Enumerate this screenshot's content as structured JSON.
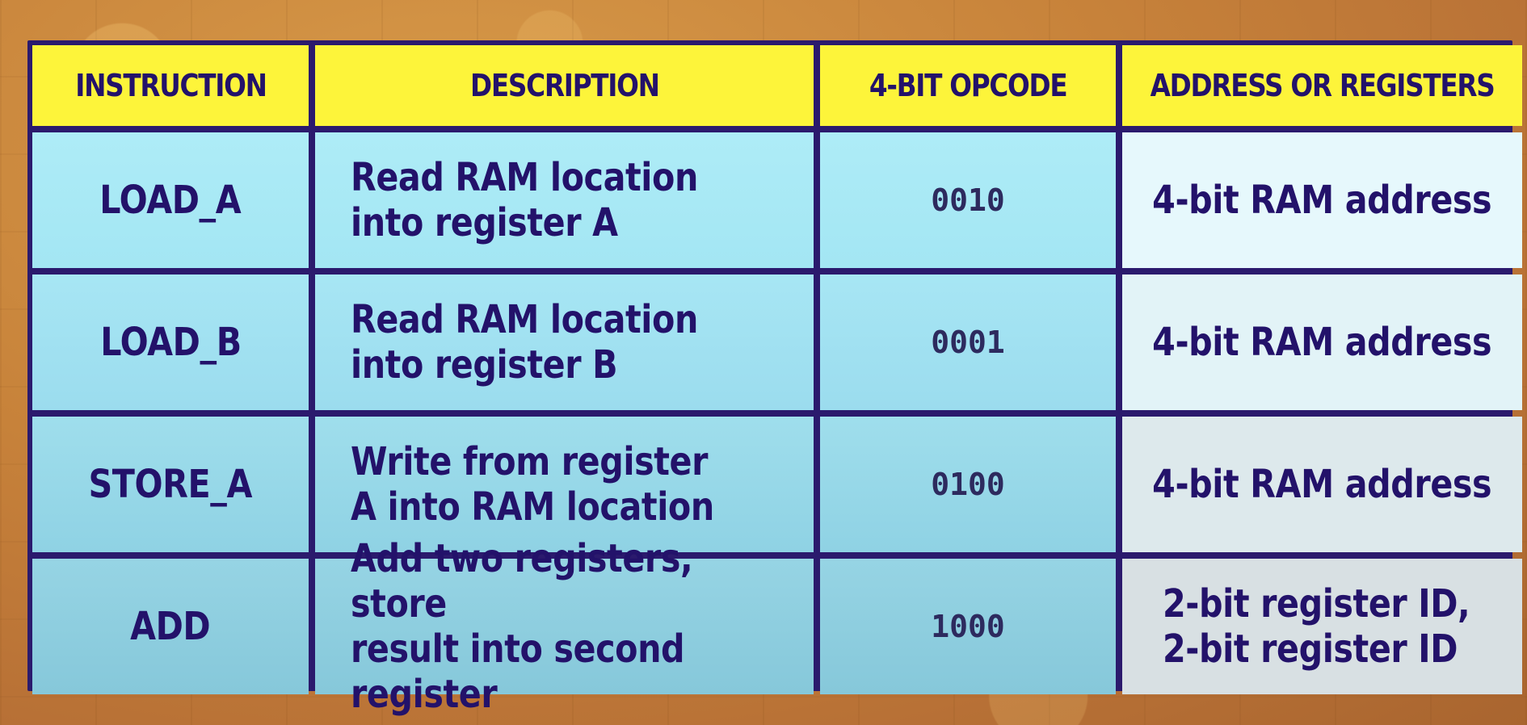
{
  "headers": {
    "instruction": "INSTRUCTION",
    "description": "DESCRIPTION",
    "opcode": "4-BIT OPCODE",
    "address": "ADDRESS OR REGISTERS"
  },
  "rows": [
    {
      "instruction": "LOAD_A",
      "description": "Read RAM location\ninto register A",
      "opcode": "0010",
      "address": "4-bit RAM address"
    },
    {
      "instruction": "LOAD_B",
      "description": "Read RAM location\ninto register B",
      "opcode": "0001",
      "address": "4-bit RAM address"
    },
    {
      "instruction": "STORE_A",
      "description": "Write from register\nA into RAM location",
      "opcode": "0100",
      "address": "4-bit RAM address"
    },
    {
      "instruction": "ADD",
      "description": "Add two registers, store\nresult into second register",
      "opcode": "1000",
      "address": "2-bit register ID,\n2-bit register ID"
    }
  ],
  "colors": {
    "header_bg": "#fdf43a",
    "border": "#2b1a6d",
    "text": "#23126a",
    "cyan_cell": "#a3e6f3",
    "pale_cell": "#e6f8fc",
    "background": "#c7823a"
  }
}
